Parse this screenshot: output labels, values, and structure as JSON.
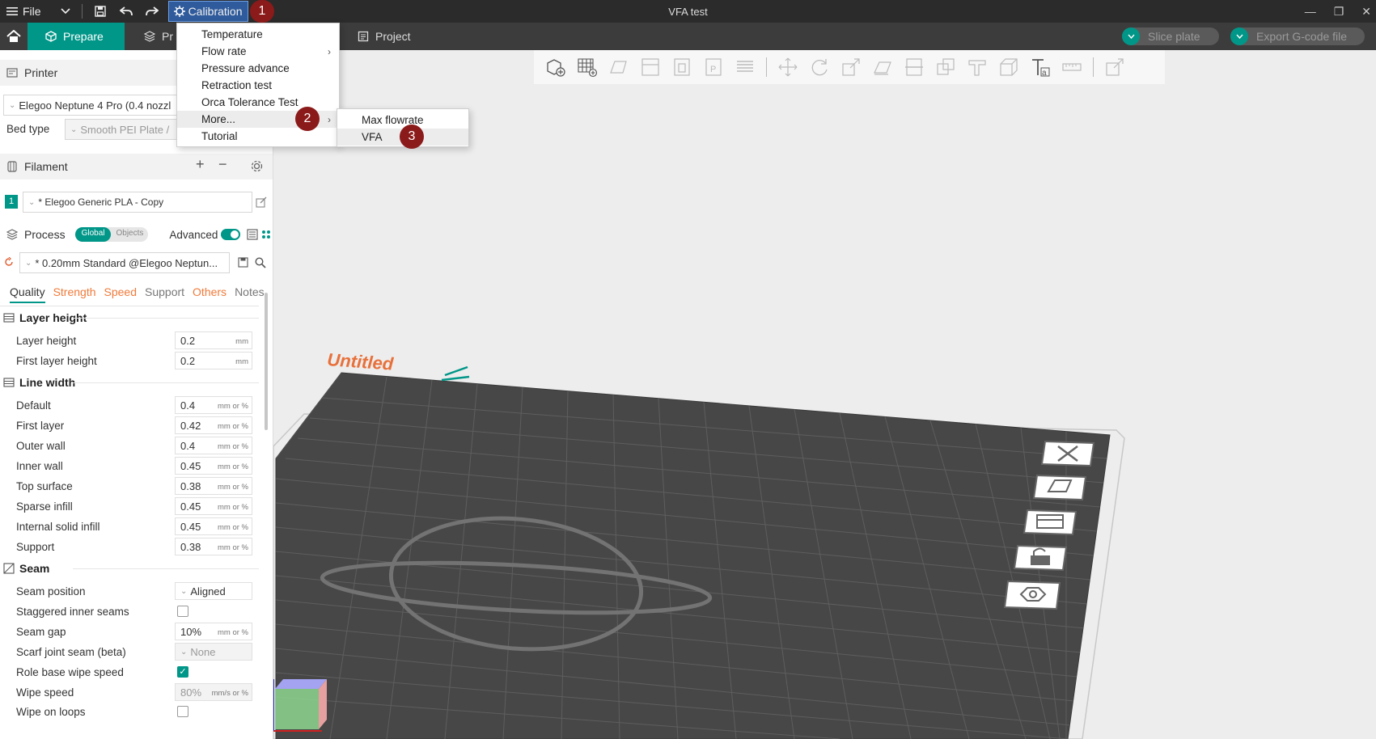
{
  "titlebar": {
    "file_label": "File",
    "calibration_label": "Calibration",
    "window_title": "VFA test",
    "window_controls": [
      "minimize-icon",
      "restore-icon",
      "close-icon"
    ]
  },
  "tabbar": {
    "prepare_label": "Prepare",
    "preview_label": "Pr",
    "project_label": "Project",
    "slice_plate_label": "Slice plate",
    "export_label": "Export G-code file",
    "accent": "#009688"
  },
  "calibration_menu": {
    "items": [
      {
        "label": "Temperature",
        "submenu": false
      },
      {
        "label": "Flow rate",
        "submenu": true
      },
      {
        "label": "Pressure advance",
        "submenu": false
      },
      {
        "label": "Retraction test",
        "submenu": false
      },
      {
        "label": "Orca Tolerance Test",
        "submenu": false
      },
      {
        "label": "More...",
        "submenu": true
      },
      {
        "label": "Tutorial",
        "submenu": false
      }
    ],
    "more_submenu": [
      "Max flowrate",
      "VFA"
    ]
  },
  "badges": [
    "1",
    "2",
    "3"
  ],
  "printer": {
    "section_label": "Printer",
    "printer_name": "Elegoo Neptune 4 Pro (0.4 nozzl",
    "bed_type_label": "Bed type",
    "bed_type_value": "Smooth PEI Plate /"
  },
  "filament": {
    "section_label": "Filament",
    "slot_number": "1",
    "filament_name": "* Elegoo Generic PLA - Copy"
  },
  "process": {
    "section_label": "Process",
    "global_label": "Global",
    "objects_label": "Objects",
    "advanced_label": "Advanced",
    "preset_name": "* 0.20mm Standard @Elegoo Neptun...",
    "tabs": [
      "Quality",
      "Strength",
      "Speed",
      "Support",
      "Others",
      "Notes"
    ]
  },
  "settings": {
    "layer_height_group": "Layer height",
    "layer_height_rows": [
      {
        "label": "Layer height",
        "value": "0.2",
        "unit": "mm"
      },
      {
        "label": "First layer height",
        "value": "0.2",
        "unit": "mm"
      }
    ],
    "line_width_group": "Line width",
    "line_width_rows": [
      {
        "label": "Default",
        "value": "0.4",
        "unit": "mm or %"
      },
      {
        "label": "First layer",
        "value": "0.42",
        "unit": "mm or %"
      },
      {
        "label": "Outer wall",
        "value": "0.4",
        "unit": "mm or %"
      },
      {
        "label": "Inner wall",
        "value": "0.45",
        "unit": "mm or %"
      },
      {
        "label": "Top surface",
        "value": "0.38",
        "unit": "mm or %"
      },
      {
        "label": "Sparse infill",
        "value": "0.45",
        "unit": "mm or %"
      },
      {
        "label": "Internal solid infill",
        "value": "0.45",
        "unit": "mm or %"
      },
      {
        "label": "Support",
        "value": "0.38",
        "unit": "mm or %"
      }
    ],
    "seam_group": "Seam",
    "seam_position_label": "Seam position",
    "seam_position_value": "Aligned",
    "staggered_label": "Staggered inner seams",
    "seam_gap_label": "Seam gap",
    "seam_gap_value": "10%",
    "seam_gap_unit": "mm or %",
    "scarf_label": "Scarf joint seam (beta)",
    "scarf_value": "None",
    "role_wipe_label": "Role base wipe speed",
    "wipe_speed_label": "Wipe speed",
    "wipe_speed_value": "80%",
    "wipe_speed_unit": "mm/s or %",
    "wipe_loops_label": "Wipe on loops"
  },
  "plate": {
    "label": "Untitled"
  }
}
